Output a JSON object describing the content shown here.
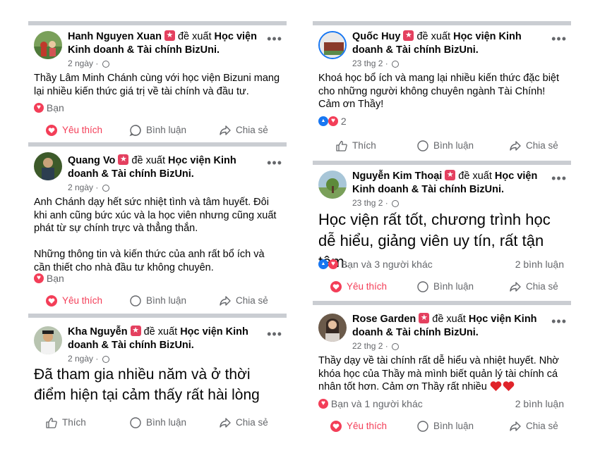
{
  "colors": {
    "heart": "#f33e58",
    "like_blue": "#1877f2",
    "separator": "#cacdd2",
    "badge": "#e4405f",
    "muted": "#65676b"
  },
  "common": {
    "verb": "để xuất",
    "page": "Học viện Kinh doanh & Tài chính BizUni.",
    "more": "•••",
    "like": "Thích",
    "love": "Yêu thích",
    "comment": "Bình luận",
    "share": "Chia sẻ"
  },
  "posts": [
    {
      "name": "Hanh Nguyen Xuan",
      "verb": "đề xuất",
      "page": "Học viện Kinh doanh & Tài chính BizUni.",
      "time": "2 ngày ·",
      "text": "Thầy Lâm Minh Chánh cùng với học viện Bizuni mang lại nhiều kiến thức giá trị về tài chính và đầu tư.",
      "reactions": "Bạn",
      "action_primary": "Yêu thích",
      "action_comment": "Bình luận",
      "action_share": "Chia sẻ"
    },
    {
      "name": "Quang Vo",
      "verb": "đề xuất",
      "page": "Học viện Kinh doanh & Tài chính BizUni.",
      "time": "2 ngày ·",
      "text": "Anh Chánh dạy hết sức nhiệt tình và tâm huyết. Đôi khi anh cũng bức xúc và la học viên nhưng cũng xuất phát từ sự chính trực và thẳng thắn.\n\nNhững thông tin và kiến thức của anh rất bổ ích và cần thiết cho nhà đầu tư không chuyên.",
      "reactions": "Bạn",
      "action_primary": "Yêu thích",
      "action_comment": "Bình luận",
      "action_share": "Chia sẻ"
    },
    {
      "name": "Kha Nguyễn",
      "verb": "đề xuất",
      "page": "Học viện Kinh doanh & Tài chính BizUni.",
      "time": "2 ngày ·",
      "text": "Đã tham gia nhiều năm và ở thời điểm hiện tại cảm thấy rất hài lòng",
      "action_primary": "Thích",
      "action_comment": "Bình luận",
      "action_share": "Chia sẻ"
    },
    {
      "name": "Quốc Huy",
      "verb": "đề xuất",
      "page": "Học viện Kinh doanh & Tài chính BizUni.",
      "time": "23 thg 2 ·",
      "text": "Khoá học bổ ích và mang lại nhiều kiến thức đặc biệt cho những người không chuyên ngành Tài Chính!\nCảm ơn Thầy!",
      "reactions": "2",
      "action_primary": "Thích",
      "action_comment": "Bình luận",
      "action_share": "Chia sẻ"
    },
    {
      "name": "Nguyễn Kim Thoại",
      "verb": "đề xuất",
      "page": "Học viện Kinh doanh & Tài chính BizUni.",
      "time": "23 thg 2 ·",
      "text": "Học viện rất tốt, chương trình học dễ hiểu, giảng viên uy tín, rất tận tâm.",
      "reactions": "Bạn và 3 người khác",
      "comments": "2 bình luận",
      "action_primary": "Yêu thích",
      "action_comment": "Bình luận",
      "action_share": "Chia sẻ"
    },
    {
      "name": "Rose Garden",
      "verb": "đề xuất",
      "page": "Học viện Kinh doanh & Tài chính BizUni.",
      "time": "22 thg 2 ·",
      "text": "Thầy dạy về tài chính rất dễ hiểu và nhiệt huyết. Nhờ khóa học của Thầy mà mình biết quản lý tài chính cá nhân tốt hơn. Cảm ơn Thầy rất nhiều",
      "reactions": "Bạn và 1 người khác",
      "comments": "2 bình luận",
      "action_primary": "Yêu thích",
      "action_comment": "Bình luận",
      "action_share": "Chia sẻ"
    }
  ]
}
